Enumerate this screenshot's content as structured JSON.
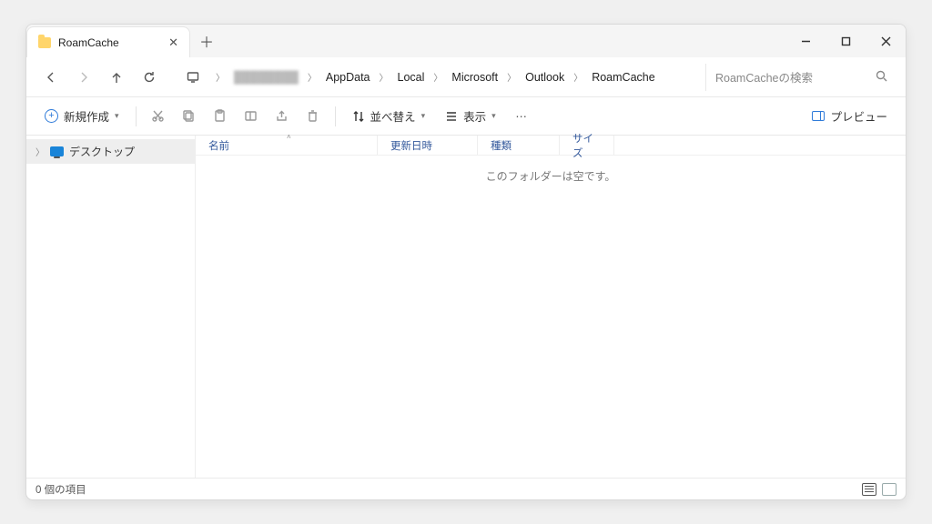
{
  "tab": {
    "title": "RoamCache"
  },
  "breadcrumb": {
    "items": [
      "AppData",
      "Local",
      "Microsoft",
      "Outlook",
      "RoamCache"
    ]
  },
  "search": {
    "placeholder": "RoamCacheの検索"
  },
  "toolbar": {
    "new_label": "新規作成",
    "sort_label": "並べ替え",
    "view_label": "表示",
    "preview_label": "プレビュー"
  },
  "sidebar": {
    "desktop_label": "デスクトップ"
  },
  "columns": {
    "name": "名前",
    "date": "更新日時",
    "type": "種類",
    "size": "サイズ"
  },
  "content": {
    "empty_msg": "このフォルダーは空です。"
  },
  "status": {
    "count_label": "0 個の項目"
  }
}
